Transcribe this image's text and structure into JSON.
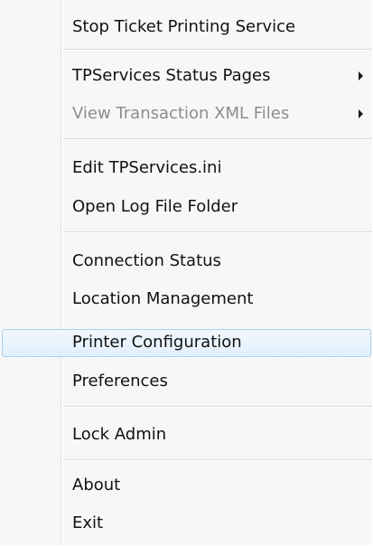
{
  "menu": {
    "items": [
      {
        "label": "Stop Ticket Printing Service"
      },
      {
        "label": "TPServices Status Pages"
      },
      {
        "label": "View Transaction XML Files"
      },
      {
        "label": "Edit TPServices.ini"
      },
      {
        "label": "Open Log File Folder"
      },
      {
        "label": "Connection Status"
      },
      {
        "label": "Location Management"
      },
      {
        "label": "Printer Configuration"
      },
      {
        "label": "Preferences"
      },
      {
        "label": "Lock Admin"
      },
      {
        "label": "About"
      },
      {
        "label": "Exit"
      }
    ],
    "disabled_item": "View Transaction XML Files",
    "hovered_item": "Printer Configuration",
    "submenu_items": [
      "TPServices Status Pages",
      "View Transaction XML Files"
    ]
  },
  "colors": {
    "menu_background": "#f7f7f7",
    "text": "#111111",
    "disabled_text": "#8c8c8c",
    "hover_border": "#a8d2f0",
    "hover_fill": "#e8f3fc"
  },
  "icons": {
    "submenu_arrow": "chevron-right-icon"
  }
}
